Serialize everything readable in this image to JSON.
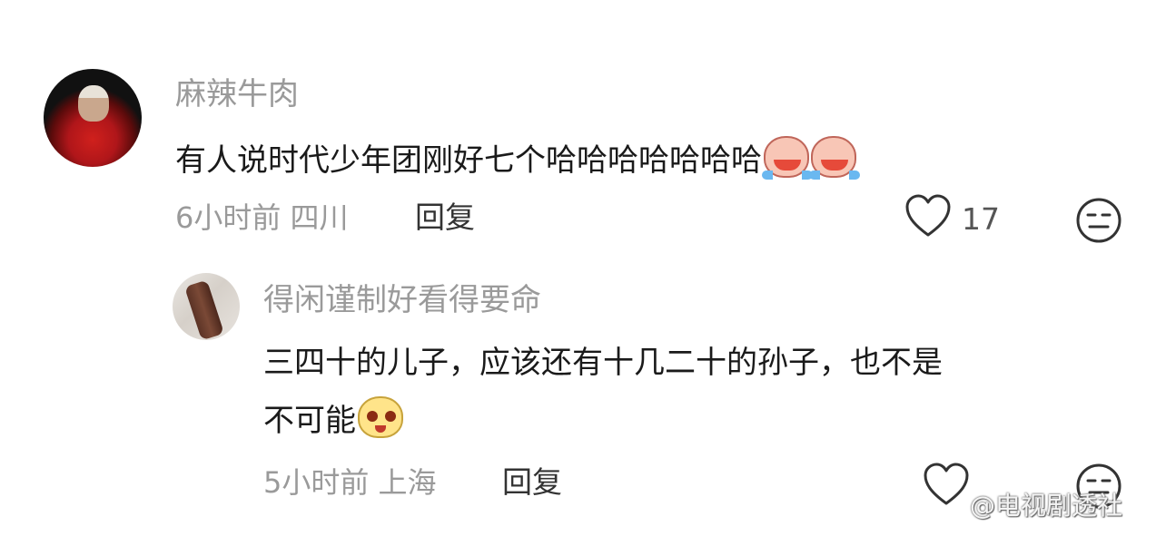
{
  "comments": [
    {
      "username": "麻辣牛肉",
      "text": "有人说时代少年团刚好七个哈哈哈哈哈哈哈",
      "emojis": [
        "crying-laugh-icon",
        "crying-laugh-icon"
      ],
      "time": "6小时前",
      "location": "四川",
      "reply_label": "回复",
      "like_count": "17"
    }
  ],
  "replies": [
    {
      "username": "得闲谨制好看得要命",
      "text_line1": "三四十的儿子，应该还有十几二十的孙子，也不是",
      "text_line2": "不可能",
      "emojis": [
        "cute-face-icon"
      ],
      "time": "5小时前",
      "location": "上海",
      "reply_label": "回复"
    }
  ],
  "watermark": {
    "text": "@电视剧透社"
  },
  "colors": {
    "meta": "#9a9a9a",
    "text": "#1a1a1a",
    "icon": "#333333"
  }
}
